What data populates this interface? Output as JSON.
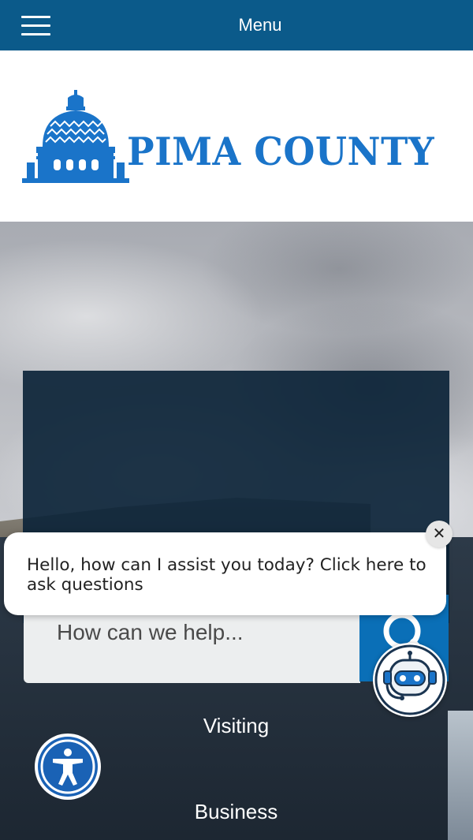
{
  "topbar": {
    "menu_label": "Menu"
  },
  "logo": {
    "text": "PIMA COUNTY",
    "color": "#1a74c9"
  },
  "search": {
    "placeholder": "How can we help..."
  },
  "nav": {
    "items": [
      {
        "label": "Visiting"
      },
      {
        "label": "Business"
      }
    ]
  },
  "chat": {
    "message": "Hello, how can I assist you today? Click here to ask questions",
    "close_label": "✕"
  },
  "colors": {
    "topbar": "#0b5a8a",
    "search_button": "#0a6fb7",
    "accessibility": "#1a62b5"
  },
  "icons": {
    "menu": "hamburger-icon",
    "search": "search-icon",
    "bot": "chatbot-icon",
    "accessibility": "accessibility-icon",
    "close": "close-icon"
  }
}
